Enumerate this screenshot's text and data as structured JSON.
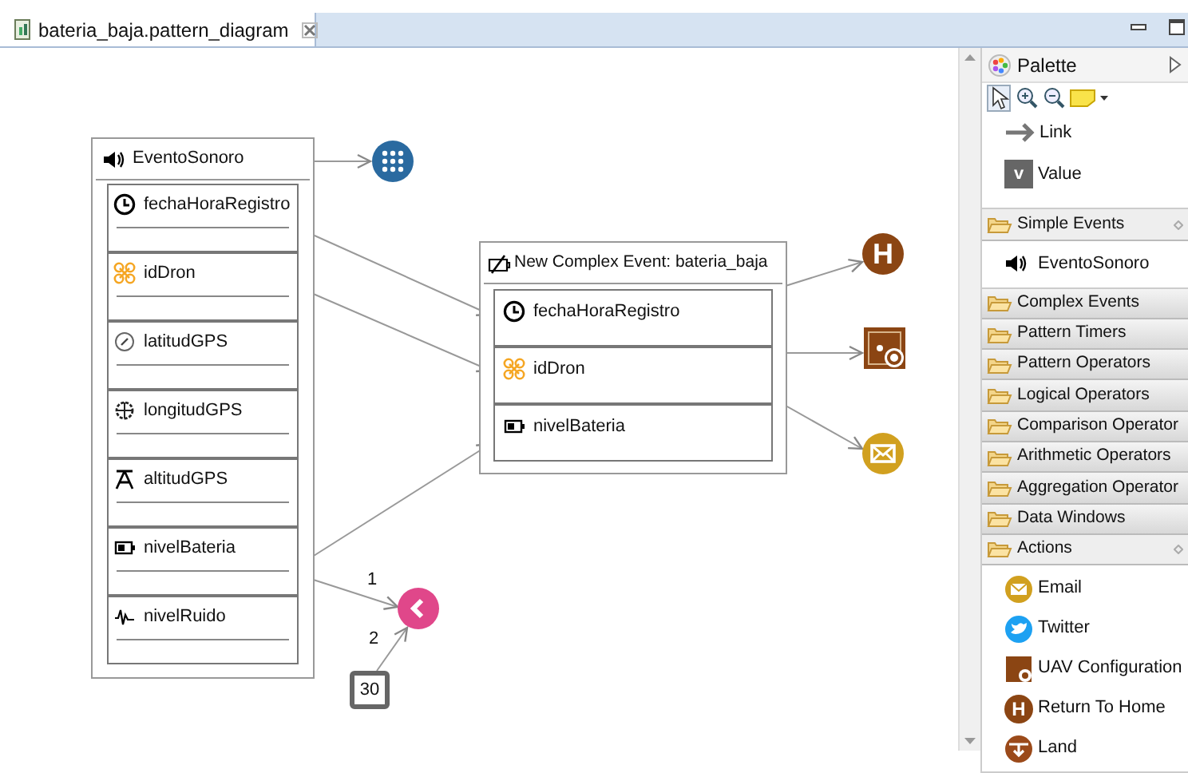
{
  "tab": {
    "title": "bateria_baja.pattern_diagram"
  },
  "diagram": {
    "simple_event": {
      "name": "EventoSonoro",
      "attributes": [
        "fechaHoraRegistro",
        "idDron",
        "latitudGPS",
        "longitudGPS",
        "altitudGPS",
        "nivelBateria",
        "nivelRuido"
      ]
    },
    "complex_event": {
      "name": "New Complex Event: bateria_baja",
      "attributes": [
        "fechaHoraRegistro",
        "idDron",
        "nivelBateria"
      ]
    },
    "actions": [
      {
        "kind": "return_home",
        "glyph": "H"
      },
      {
        "kind": "uav_config"
      },
      {
        "kind": "email"
      }
    ],
    "operator": {
      "inputs": [
        "1",
        "2"
      ]
    },
    "value": "30"
  },
  "palette": {
    "title": "Palette",
    "tools": [
      {
        "label": "Link"
      },
      {
        "label": "Value",
        "glyph": "v"
      }
    ],
    "groups": [
      {
        "label": "Simple Events",
        "expanded": true,
        "items": [
          {
            "kind": "sound",
            "label": "EventoSonoro"
          }
        ]
      },
      {
        "label": "Complex Events",
        "expanded": false
      },
      {
        "label": "Pattern Timers",
        "expanded": false
      },
      {
        "label": "Pattern Operators",
        "expanded": false
      },
      {
        "label": "Logical Operators",
        "expanded": false
      },
      {
        "label": "Comparison Operator",
        "expanded": false
      },
      {
        "label": "Arithmetic Operators",
        "expanded": false
      },
      {
        "label": "Aggregation Operator",
        "expanded": false
      },
      {
        "label": "Data Windows",
        "expanded": false
      },
      {
        "label": "Actions",
        "expanded": true,
        "items": [
          {
            "kind": "email",
            "label": "Email"
          },
          {
            "kind": "twitter",
            "label": "Twitter"
          },
          {
            "kind": "uav_config",
            "label": "UAV Configuration"
          },
          {
            "kind": "return_home",
            "label": "Return To Home",
            "glyph": "H"
          },
          {
            "kind": "land",
            "label": "Land"
          }
        ]
      }
    ]
  }
}
